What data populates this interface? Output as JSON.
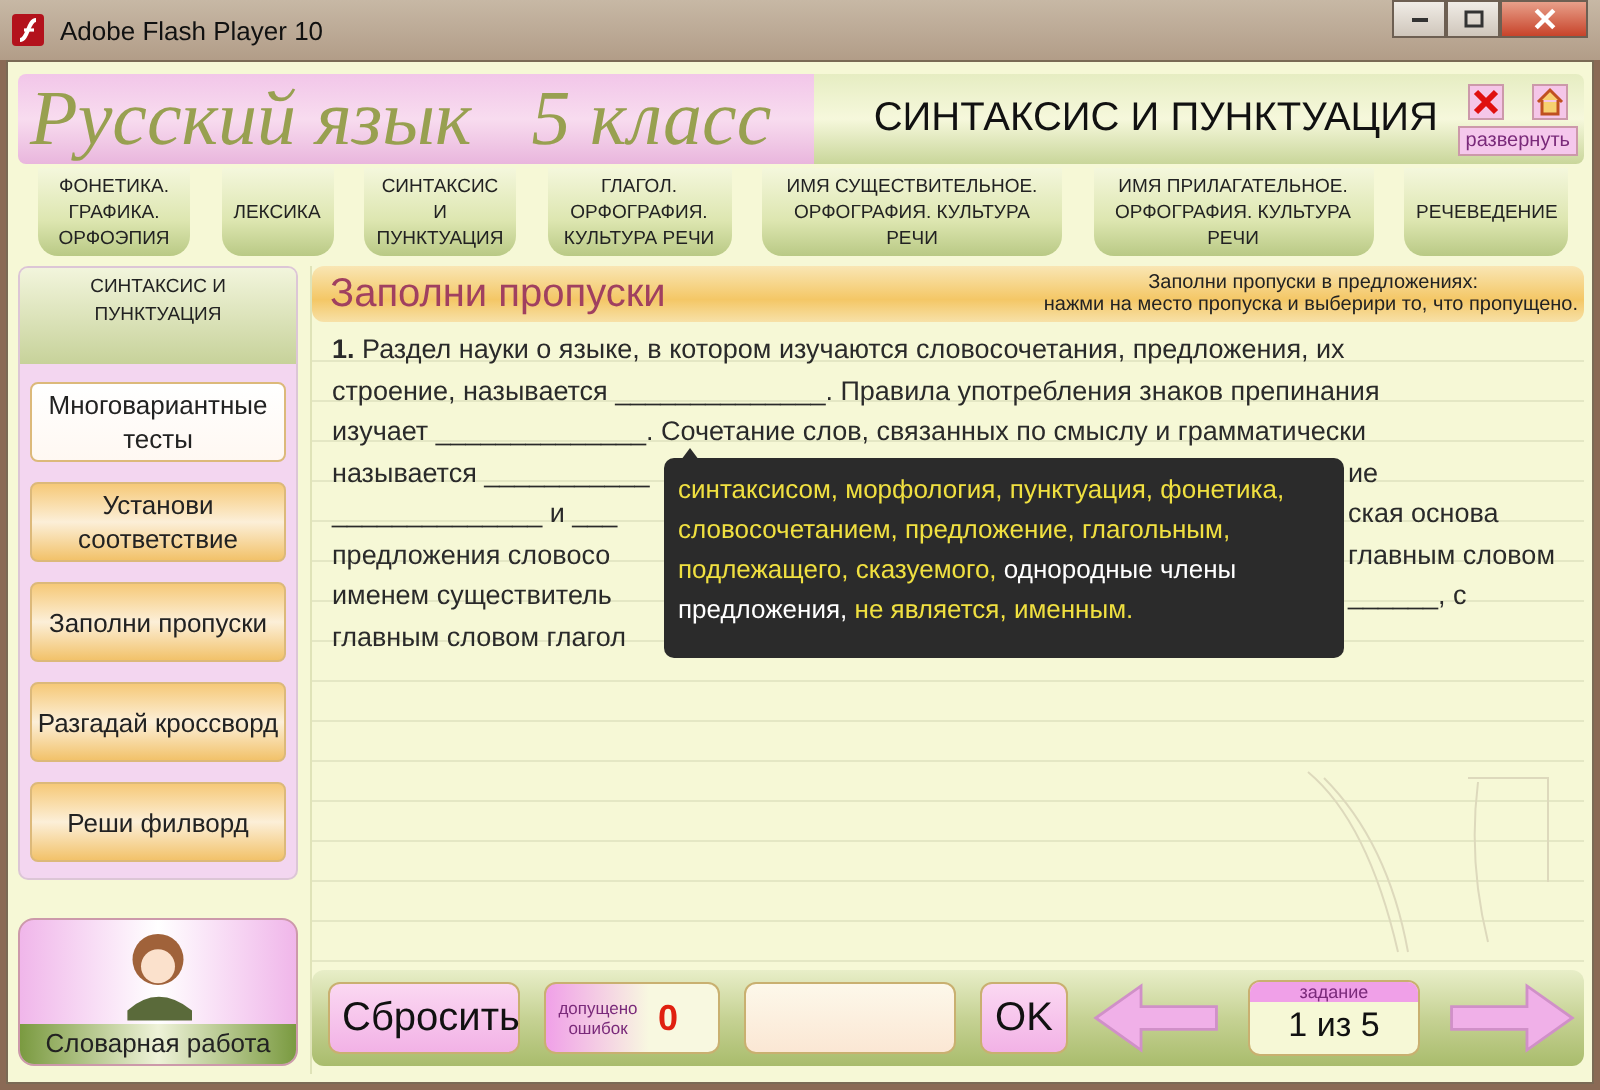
{
  "window": {
    "title": "Adobe Flash Player 10"
  },
  "header": {
    "title_left": "Русский язык",
    "title_grade": "5 класс",
    "section": "СИНТАКСИС И ПУНКТУАЦИЯ",
    "expand_label": "развернуть"
  },
  "tabs": [
    {
      "label": "ФОНЕТИКА. ГРАФИКА. ОРФОЭПИЯ"
    },
    {
      "label": "ЛЕКСИКА"
    },
    {
      "label": "СИНТАКСИС И ПУНКТУАЦИЯ"
    },
    {
      "label": "ГЛАГОЛ. ОРФОГРАФИЯ. КУЛЬТУРА РЕЧИ"
    },
    {
      "label": "ИМЯ СУЩЕСТВИТЕЛЬНОЕ. ОРФОГРАФИЯ. КУЛЬТУРА РЕЧИ"
    },
    {
      "label": "ИМЯ ПРИЛАГАТЕЛЬНОЕ. ОРФОГРАФИЯ. КУЛЬТУРА РЕЧИ"
    },
    {
      "label": "РЕЧЕВЕДЕНИЕ"
    }
  ],
  "sidebar": {
    "title": "СИНТАКСИС И ПУНКТУАЦИЯ",
    "items": [
      {
        "label": "Многовариантные тесты",
        "highlighted": true
      },
      {
        "label": "Установи соответствие",
        "highlighted": false
      },
      {
        "label": "Заполни пропуски",
        "highlighted": false
      },
      {
        "label": "Разгадай кроссворд",
        "highlighted": false
      },
      {
        "label": "Реши филворд",
        "highlighted": false
      }
    ],
    "vocabulary_label": "Словарная работа"
  },
  "task": {
    "title": "Заполни пропуски",
    "instruction_line1": "Заполни пропуски в предложениях:",
    "instruction_line2": "нажми на место пропуска и выберири то, что пропущено.",
    "lines": [
      {
        "left": "**1.** Раздел науки о языке, в котором изучаются словосочетания, предложения, их"
      },
      {
        "left": "строение, называется ______________. Правила употребления знаков препинания"
      },
      {
        "left": "изучает ______________. Сочетание слов, связанных по смыслу и грамматически"
      },
      {
        "left": "называется ___________",
        "right": "ие"
      },
      {
        "left": "______________ и ___",
        "right": "ская основа"
      },
      {
        "left": "предложения словосо",
        "right": "главным словом"
      },
      {
        "left": "именем существитель",
        "right": "______, с"
      },
      {
        "left": "главным словом глагол"
      }
    ],
    "options": [
      {
        "text": "синтаксисом,",
        "highlighted": true
      },
      {
        "text": "морфология,",
        "highlighted": true
      },
      {
        "text": "пунктуация,",
        "highlighted": true
      },
      {
        "text": "фонетика,",
        "highlighted": true
      },
      {
        "text": "словосочетанием,",
        "highlighted": true
      },
      {
        "text": "предложение,",
        "highlighted": true
      },
      {
        "text": "глагольным,",
        "highlighted": true
      },
      {
        "text": "подлежащего,",
        "highlighted": true
      },
      {
        "text": "сказуемого,",
        "highlighted": true
      },
      {
        "text": "однородные члены предложения,",
        "highlighted": false
      },
      {
        "text": "не является,",
        "highlighted": true
      },
      {
        "text": "именным.",
        "highlighted": true
      }
    ]
  },
  "footer": {
    "reset": "Сбросить",
    "errors_label": "допущено ошибок",
    "errors_count": "0",
    "ok": "OK",
    "task_label": "задание",
    "task_counter": "1 из 5"
  }
}
